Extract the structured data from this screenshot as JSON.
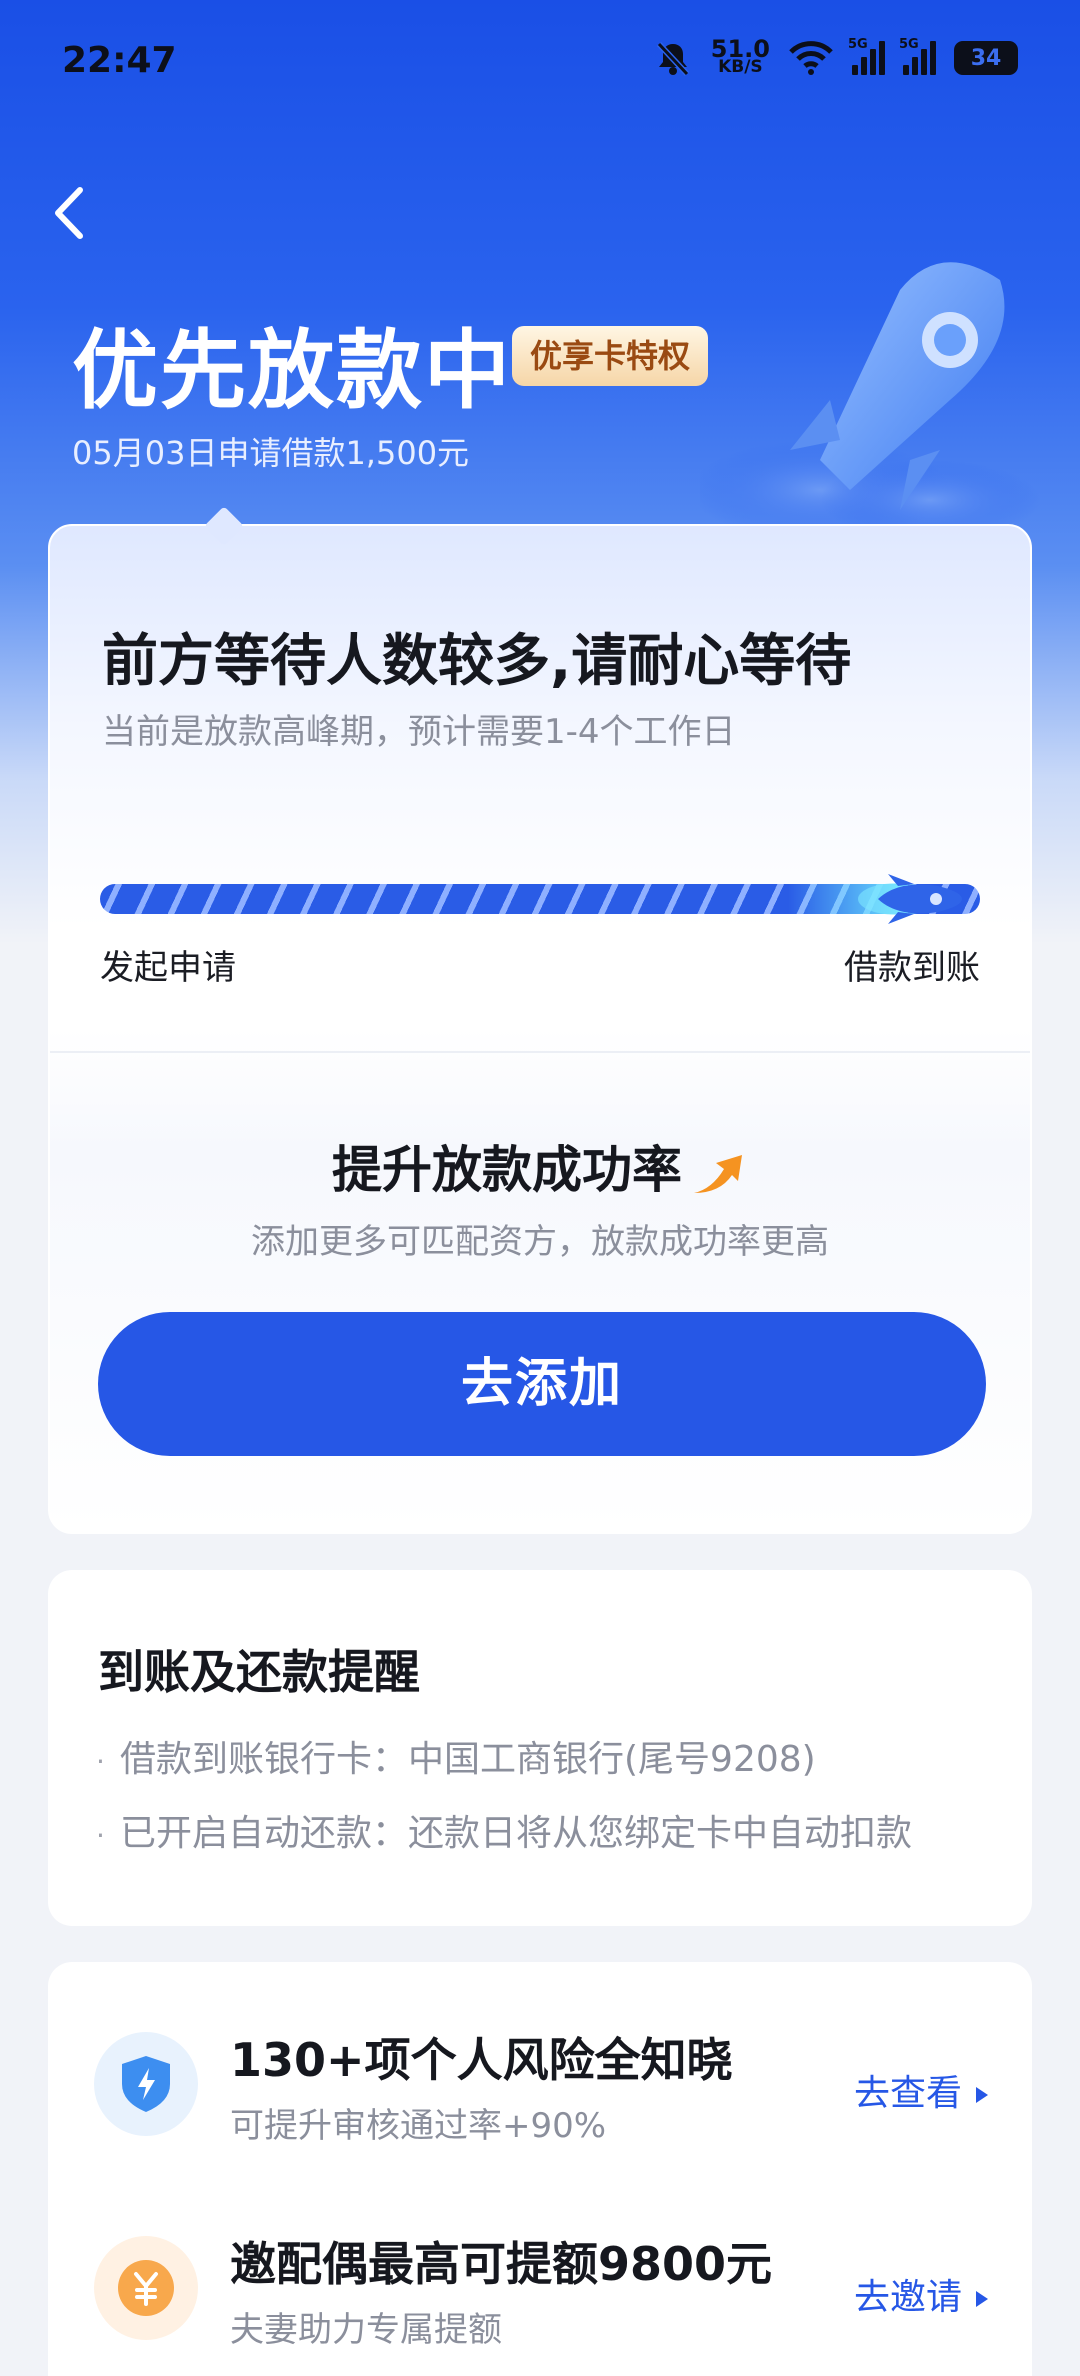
{
  "status_bar": {
    "time": "22:47",
    "speed_value": "51.0",
    "speed_unit": "KB/S",
    "network_1": "5G",
    "network_2": "5G",
    "battery": "34"
  },
  "header": {
    "title": "优先放款中",
    "badge": "优享卡特权",
    "subtitle": "05月03日申请借款1,500元"
  },
  "progress_card": {
    "title": "前方等待人数较多,请耐心等待",
    "subtitle": "当前是放款高峰期，预计需要1-4个工作日",
    "progress_fraction": 0.93,
    "start_label": "发起申请",
    "end_label": "借款到账",
    "boost_title": "提升放款成功率",
    "boost_subtitle": "添加更多可匹配资方，放款成功率更高",
    "add_button": "去添加"
  },
  "reminder_card": {
    "title": "到账及还款提醒",
    "items": [
      "借款到账银行卡：中国工商银行(尾号9208)",
      "已开启自动还款：还款日将从您绑定卡中自动扣款"
    ]
  },
  "services": [
    {
      "icon": "shield-icon",
      "title": "130+项个人风险全知晓",
      "desc": "可提升审核通过率+90%",
      "action": "去查看"
    },
    {
      "icon": "yuan-coin-icon",
      "title": "邀配偶最高可提额9800元",
      "desc": "夫妻助力专属提额",
      "action": "去邀请"
    }
  ],
  "colors": {
    "primary": "#2657e6",
    "hero_top": "#1a4fe6",
    "badge_text": "#9a4a12",
    "muted_text": "#8b8f9c"
  }
}
